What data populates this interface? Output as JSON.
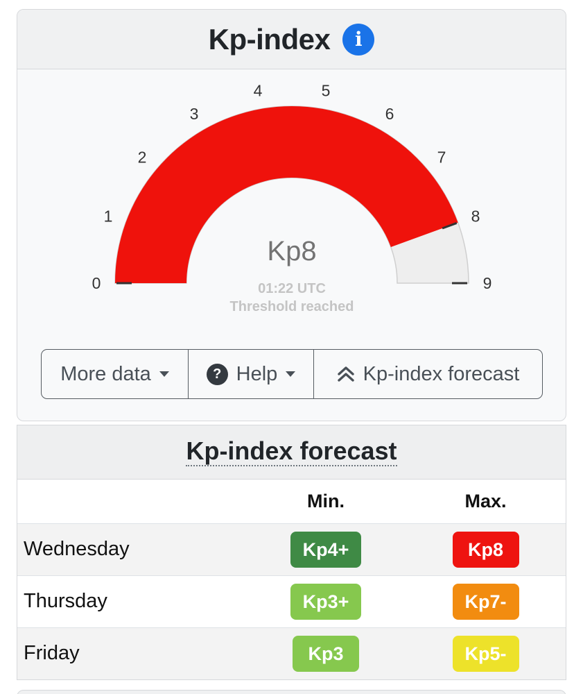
{
  "header": {
    "title": "Kp-index",
    "info_icon": "info-icon",
    "info_glyph": "i"
  },
  "gauge": {
    "min": 0,
    "max": 9,
    "value": 8,
    "ticks": [
      "0",
      "1",
      "2",
      "3",
      "4",
      "5",
      "6",
      "7",
      "8",
      "9"
    ],
    "value_label": "Kp8",
    "time": "01:22 UTC",
    "status": "Threshold reached",
    "colors": {
      "fill": "#ef120c",
      "track": "#eeeeee",
      "text": "#737373",
      "subtext": "#c4c4c4"
    }
  },
  "buttons": {
    "more_data": "More data",
    "help": "Help",
    "help_glyph": "?",
    "forecast": "Kp-index forecast",
    "forecast_glyph": "⌃"
  },
  "forecast": {
    "title": "Kp-index forecast",
    "col_min": "Min.",
    "col_max": "Max.",
    "rows": [
      {
        "day": "Wednesday",
        "min": "Kp4+",
        "min_color": "#3f8a45",
        "max": "Kp8",
        "max_color": "#ee1410"
      },
      {
        "day": "Thursday",
        "min": "Kp3+",
        "min_color": "#86c84e",
        "max": "Kp7-",
        "max_color": "#f28c10"
      },
      {
        "day": "Friday",
        "min": "Kp3",
        "min_color": "#86c84e",
        "max": "Kp5-",
        "max_color": "#ede22a"
      }
    ]
  }
}
